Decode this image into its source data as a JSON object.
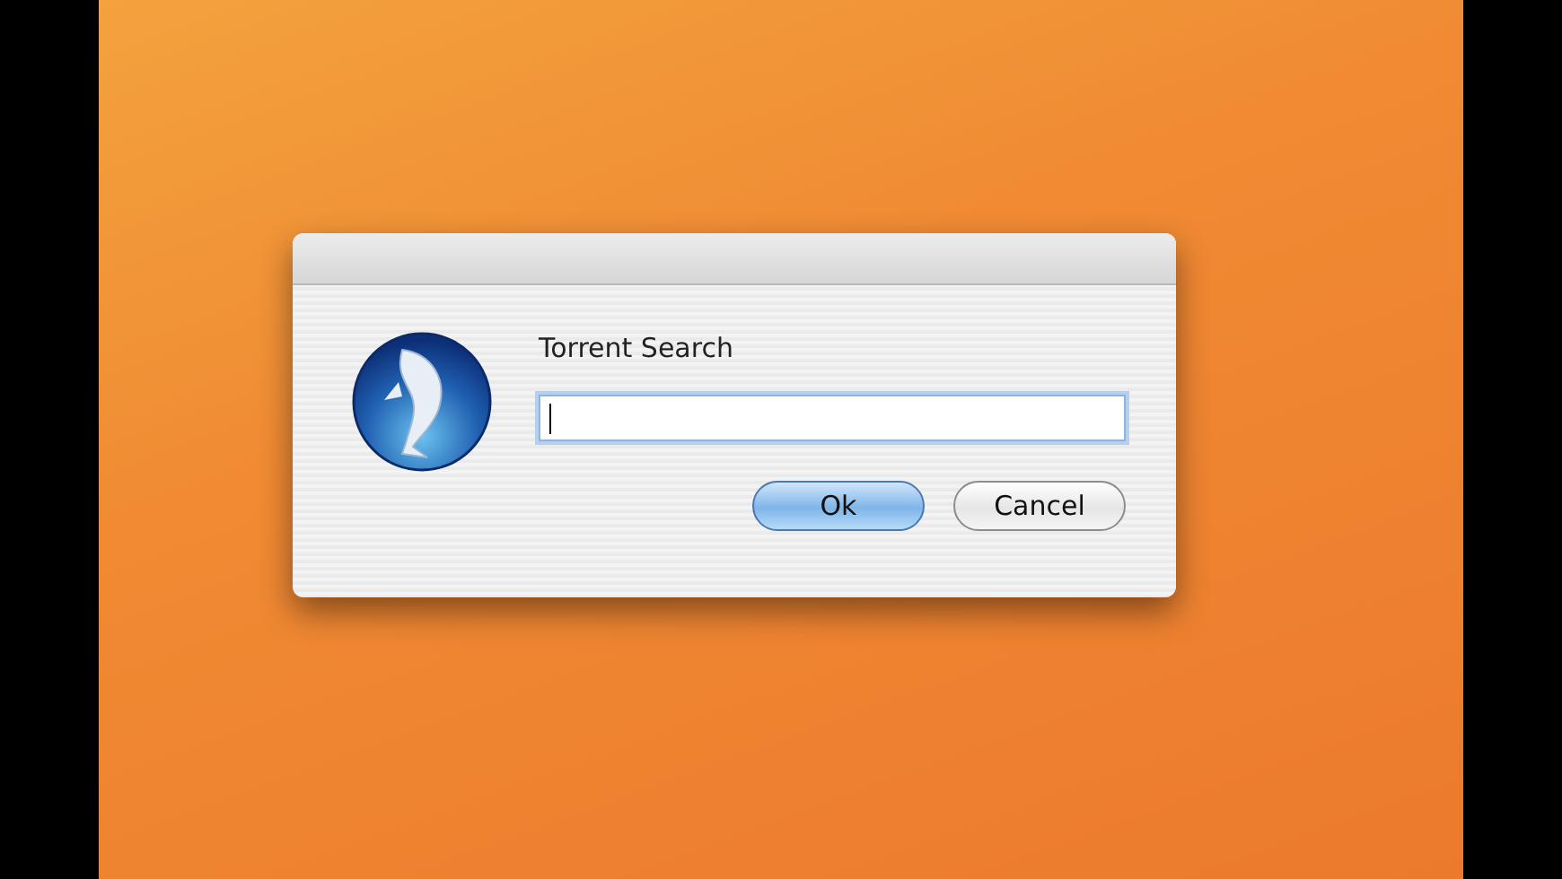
{
  "dialog": {
    "prompt": "Torrent Search",
    "field": {
      "focused": true
    },
    "buttons": [
      {
        "label": "Ok",
        "default": true
      },
      {
        "label": "Cancel",
        "default": false
      }
    ]
  }
}
